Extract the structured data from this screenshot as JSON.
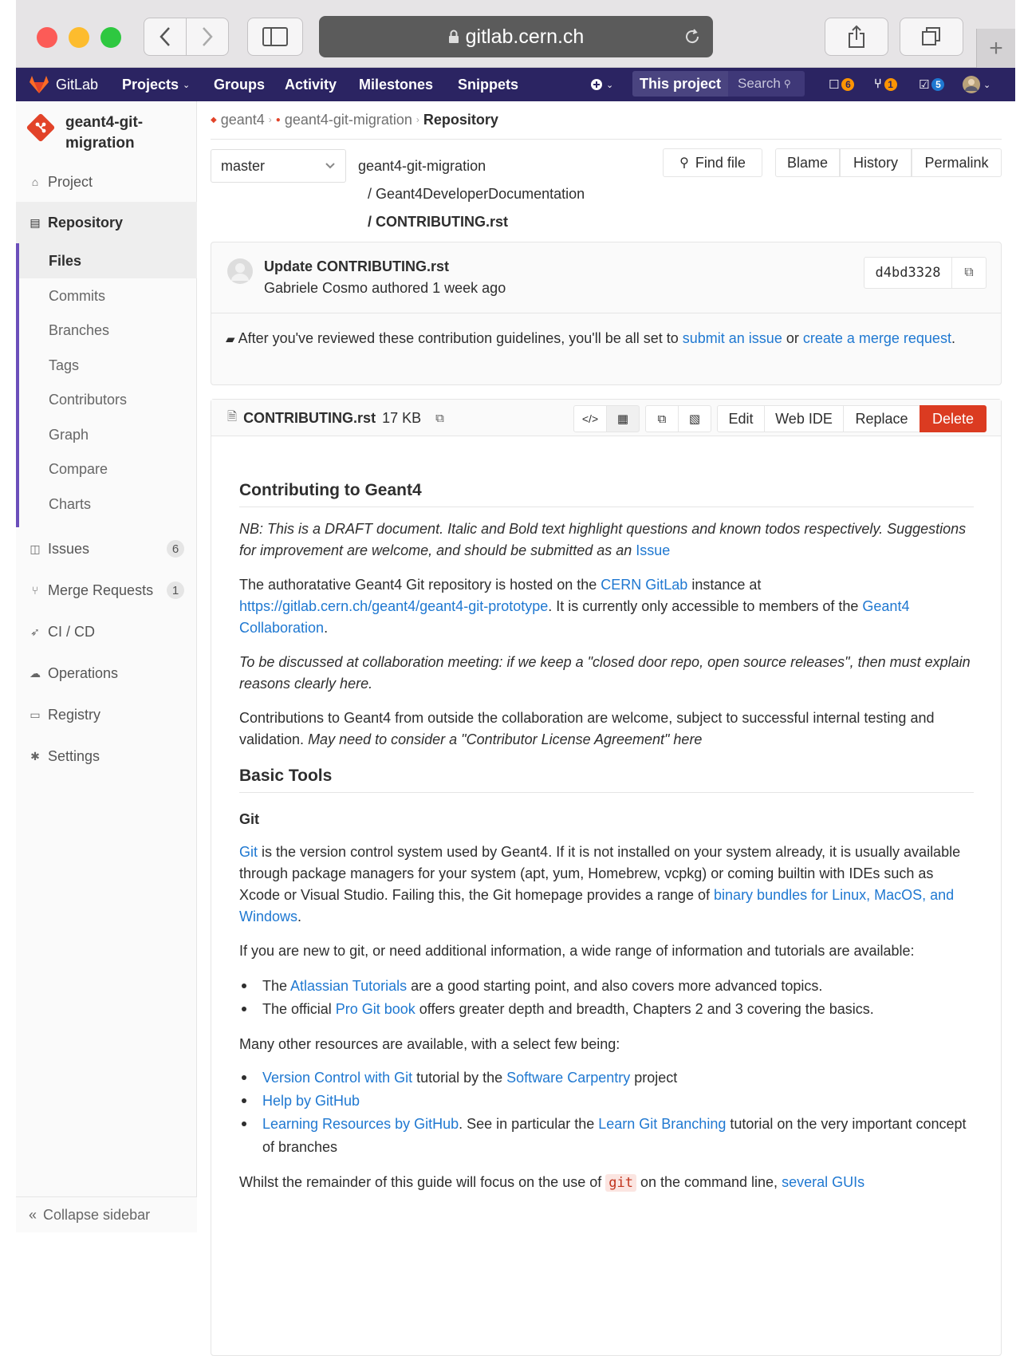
{
  "browser": {
    "url": "gitlab.cern.ch",
    "lock_icon": "lock-icon",
    "reload_icon": "reload-icon",
    "new_tab": "+"
  },
  "colors": {
    "nav": "#2b2462",
    "accent": "#6b4fbb",
    "link": "#1f78d1",
    "delete": "#db3b21"
  },
  "nav": {
    "brand": "GitLab",
    "projects": "Projects",
    "groups": "Groups",
    "activity": "Activity",
    "milestones": "Milestones",
    "snippets": "Snippets",
    "this_project": "This project",
    "search_placeholder": "Search",
    "todos_count": "6",
    "mr_count": "1",
    "issues_count": "5"
  },
  "sidebar": {
    "project_name": "geant4-git-migration",
    "items": {
      "project": "Project",
      "repository": "Repository",
      "issues": "Issues",
      "issues_count": "6",
      "merge_requests": "Merge Requests",
      "mr_count": "1",
      "cicd": "CI / CD",
      "operations": "Operations",
      "registry": "Registry",
      "settings": "Settings"
    },
    "repo_sub": [
      "Files",
      "Commits",
      "Branches",
      "Tags",
      "Contributors",
      "Graph",
      "Compare",
      "Charts"
    ],
    "collapse": "Collapse sidebar"
  },
  "breadcrumb": {
    "group": "geant4",
    "project": "geant4-git-migration",
    "current": "Repository"
  },
  "tree": {
    "branch": "master",
    "path1": "geant4-git-migration",
    "path2": "/ Geant4DeveloperDocumentation",
    "path3": "/ CONTRIBUTING.rst",
    "find_file": "Find file",
    "blame": "Blame",
    "history": "History",
    "permalink": "Permalink"
  },
  "commit": {
    "title": "Update CONTRIBUTING.rst",
    "author": "Gabriele Cosmo",
    "authored": "authored 1 week ago",
    "sha": "d4bd3328"
  },
  "notice": {
    "pre": "After you've reviewed these contribution guidelines, you'll be all set to ",
    "link1": "submit an issue",
    "mid": " or ",
    "link2": "create a merge request",
    "post": "."
  },
  "file": {
    "name": "CONTRIBUTING.rst",
    "size": "17 KB",
    "edit": "Edit",
    "webide": "Web IDE",
    "replace": "Replace",
    "delete": "Delete"
  },
  "doc": {
    "h_contrib": "Contributing to Geant4",
    "p1_pre": "NB: This is a DRAFT document. Italic and Bold text highlight questions and known todos respectively. Suggestions for improvement are welcome, and should be submitted as an ",
    "p1_link": "Issue",
    "p2_a": "The authoratative Geant4 Git repository is hosted on the ",
    "p2_link1": "CERN GitLab",
    "p2_b": " instance at ",
    "p2_link2": "https://gitlab.cern.ch/geant4/geant4-git-prototype",
    "p2_c": ". It is currently only accessible to members of the ",
    "p2_link3": "Geant4 Collaboration",
    "p2_d": ".",
    "p3": "To be discussed at collaboration meeting: if we keep a \"closed door repo, open source releases\", then must explain reasons clearly here.",
    "p4_a": "Contributions to Geant4 from outside the collaboration are welcome, subject to successful internal testing and validation. ",
    "p4_em": "May need to consider a \"Contributor License Agreement\" here",
    "h_tools": "Basic Tools",
    "h_git": "Git",
    "p5_link": "Git",
    "p5_a": " is the version control system used by Geant4. If it is not installed on your system already, it is usually available through package managers for your system (apt, yum, Homebrew, vcpkg) or coming builtin with IDEs such as Xcode or Visual Studio. Failing this, the Git homepage provides a range of ",
    "p5_link2": "binary bundles for Linux, MacOS, and Windows",
    "p5_b": ".",
    "p6": "If you are new to git, or need additional information, a wide range of information and tutorials are available:",
    "li1_a": "The ",
    "li1_link": "Atlassian Tutorials",
    "li1_b": " are a good starting point, and also covers more advanced topics.",
    "li2_a": "The official ",
    "li2_link": "Pro Git book",
    "li2_b": " offers greater depth and breadth, Chapters 2 and 3 covering the basics.",
    "p7": "Many other resources are available, with a select few being:",
    "li3_link": "Version Control with Git",
    "li3_a": " tutorial by the ",
    "li3_link2": "Software Carpentry",
    "li3_b": " project",
    "li4_link": "Help by GitHub",
    "li5_link": "Learning Resources by GitHub",
    "li5_a": ". See in particular the ",
    "li5_link2": "Learn Git Branching",
    "li5_b": " tutorial on the very important concept of branches",
    "p8_a": "Whilst the remainder of this guide will focus on the use of ",
    "p8_code": "git",
    "p8_b": " on the command line, ",
    "p8_link": "several GUIs"
  }
}
